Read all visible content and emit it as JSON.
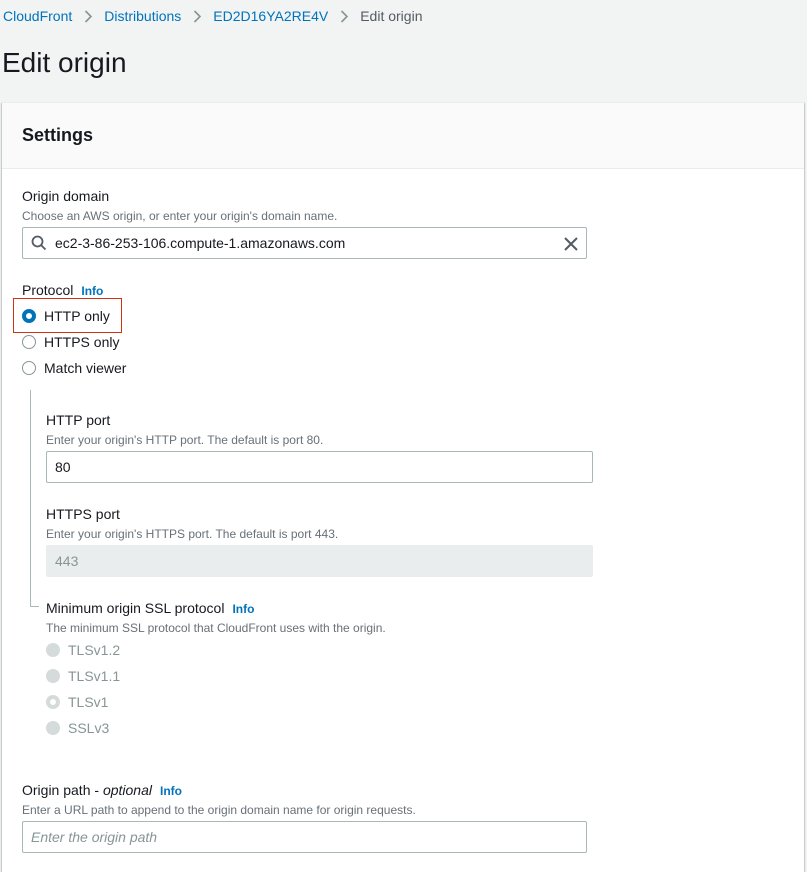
{
  "breadcrumb": {
    "items": [
      "CloudFront",
      "Distributions",
      "ED2D16YA2RE4V"
    ],
    "current": "Edit origin"
  },
  "page": {
    "title": "Edit origin"
  },
  "settings": {
    "title": "Settings",
    "origin_domain": {
      "label": "Origin domain",
      "description": "Choose an AWS origin, or enter your origin's domain name.",
      "value": "ec2-3-86-253-106.compute-1.amazonaws.com"
    },
    "protocol": {
      "label": "Protocol",
      "info": "Info",
      "options": [
        "HTTP only",
        "HTTPS only",
        "Match viewer"
      ],
      "selected": "HTTP only"
    },
    "http_port": {
      "label": "HTTP port",
      "description": "Enter your origin's HTTP port. The default is port 80.",
      "value": "80"
    },
    "https_port": {
      "label": "HTTPS port",
      "description": "Enter your origin's HTTPS port. The default is port 443.",
      "value": "443"
    },
    "min_ssl": {
      "label": "Minimum origin SSL protocol",
      "info": "Info",
      "description": "The minimum SSL protocol that CloudFront uses with the origin.",
      "options": [
        "TLSv1.2",
        "TLSv1.1",
        "TLSv1",
        "SSLv3"
      ],
      "selected": "TLSv1"
    },
    "origin_path": {
      "label": "Origin path - ",
      "label_optional": "optional",
      "info": "Info",
      "description": "Enter a URL path to append to the origin domain name for origin requests.",
      "placeholder": "Enter the origin path"
    }
  },
  "colors": {
    "link": "#0073bb",
    "highlight": "#d13212",
    "text": "#16191f",
    "muted": "#687078"
  }
}
